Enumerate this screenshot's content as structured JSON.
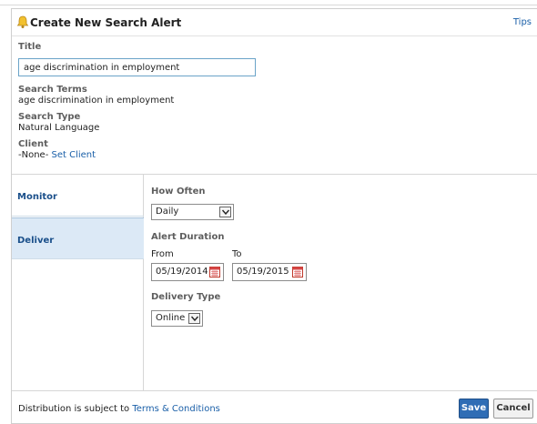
{
  "dialog": {
    "title": "Create New Search Alert",
    "tips_link": "Tips"
  },
  "info": {
    "title_label": "Title",
    "title_value": "age discrimination in employment",
    "search_terms_label": "Search Terms",
    "search_terms_value": "age discrimination in employment",
    "search_type_label": "Search Type",
    "search_type_value": "Natural Language",
    "client_label": "Client",
    "client_value": "-None-",
    "set_client_link": "Set Client"
  },
  "tabs": [
    {
      "label": "Monitor"
    },
    {
      "label": "Deliver"
    }
  ],
  "deliver": {
    "how_often_label": "How Often",
    "how_often_value": "Daily",
    "alert_duration_label": "Alert Duration",
    "from_label": "From",
    "from_value": "05/19/2014",
    "to_label": "To",
    "to_value": "05/19/2015",
    "delivery_type_label": "Delivery Type",
    "delivery_type_value": "Online"
  },
  "footer": {
    "distribution_text": "Distribution is subject to ",
    "terms_link": "Terms & Conditions",
    "save_label": "Save",
    "cancel_label": "Cancel"
  },
  "colors": {
    "accent": "#2f6db5",
    "link": "#1a5fa8",
    "tab_active_bg": "#dce9f6",
    "bell": "#f2c12e"
  },
  "icons": {
    "alert": "bell-icon",
    "calendar": "calendar-icon",
    "dropdown": "chevron-down-icon"
  }
}
